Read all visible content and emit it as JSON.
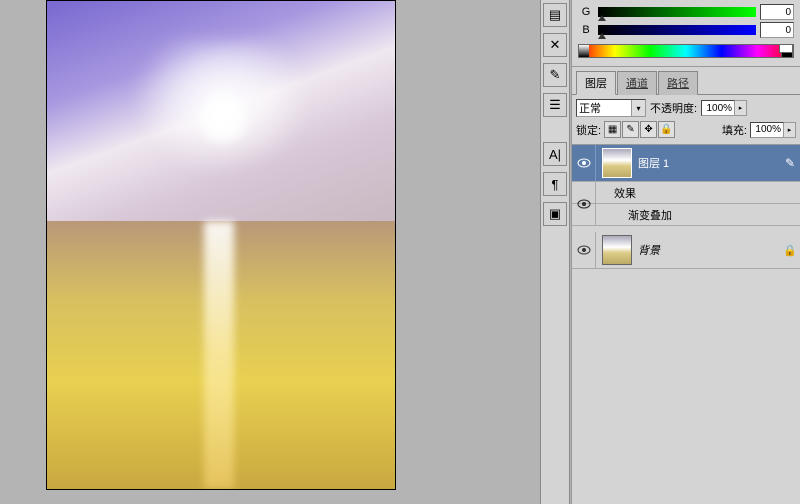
{
  "color_panel": {
    "g_label": "G",
    "b_label": "B",
    "g_value": "0",
    "b_value": "0"
  },
  "tabs": {
    "layers": "图层",
    "channels": "通道",
    "paths": "路径"
  },
  "blend": {
    "mode": "正常",
    "opacity_label": "不透明度:",
    "opacity_value": "100%"
  },
  "lock": {
    "label": "锁定:",
    "fill_label": "填充:",
    "fill_value": "100%"
  },
  "layers": [
    {
      "name": "图层 1",
      "selected": true
    },
    {
      "fx_label": "效果"
    },
    {
      "fx_name": "渐变叠加"
    },
    {
      "name": "背景",
      "locked": true,
      "italic": true
    }
  ],
  "icons": {
    "lock_trans": "▦",
    "lock_brush": "✎",
    "lock_move": "✥",
    "lock_all": "🔒",
    "brush": "✎"
  }
}
